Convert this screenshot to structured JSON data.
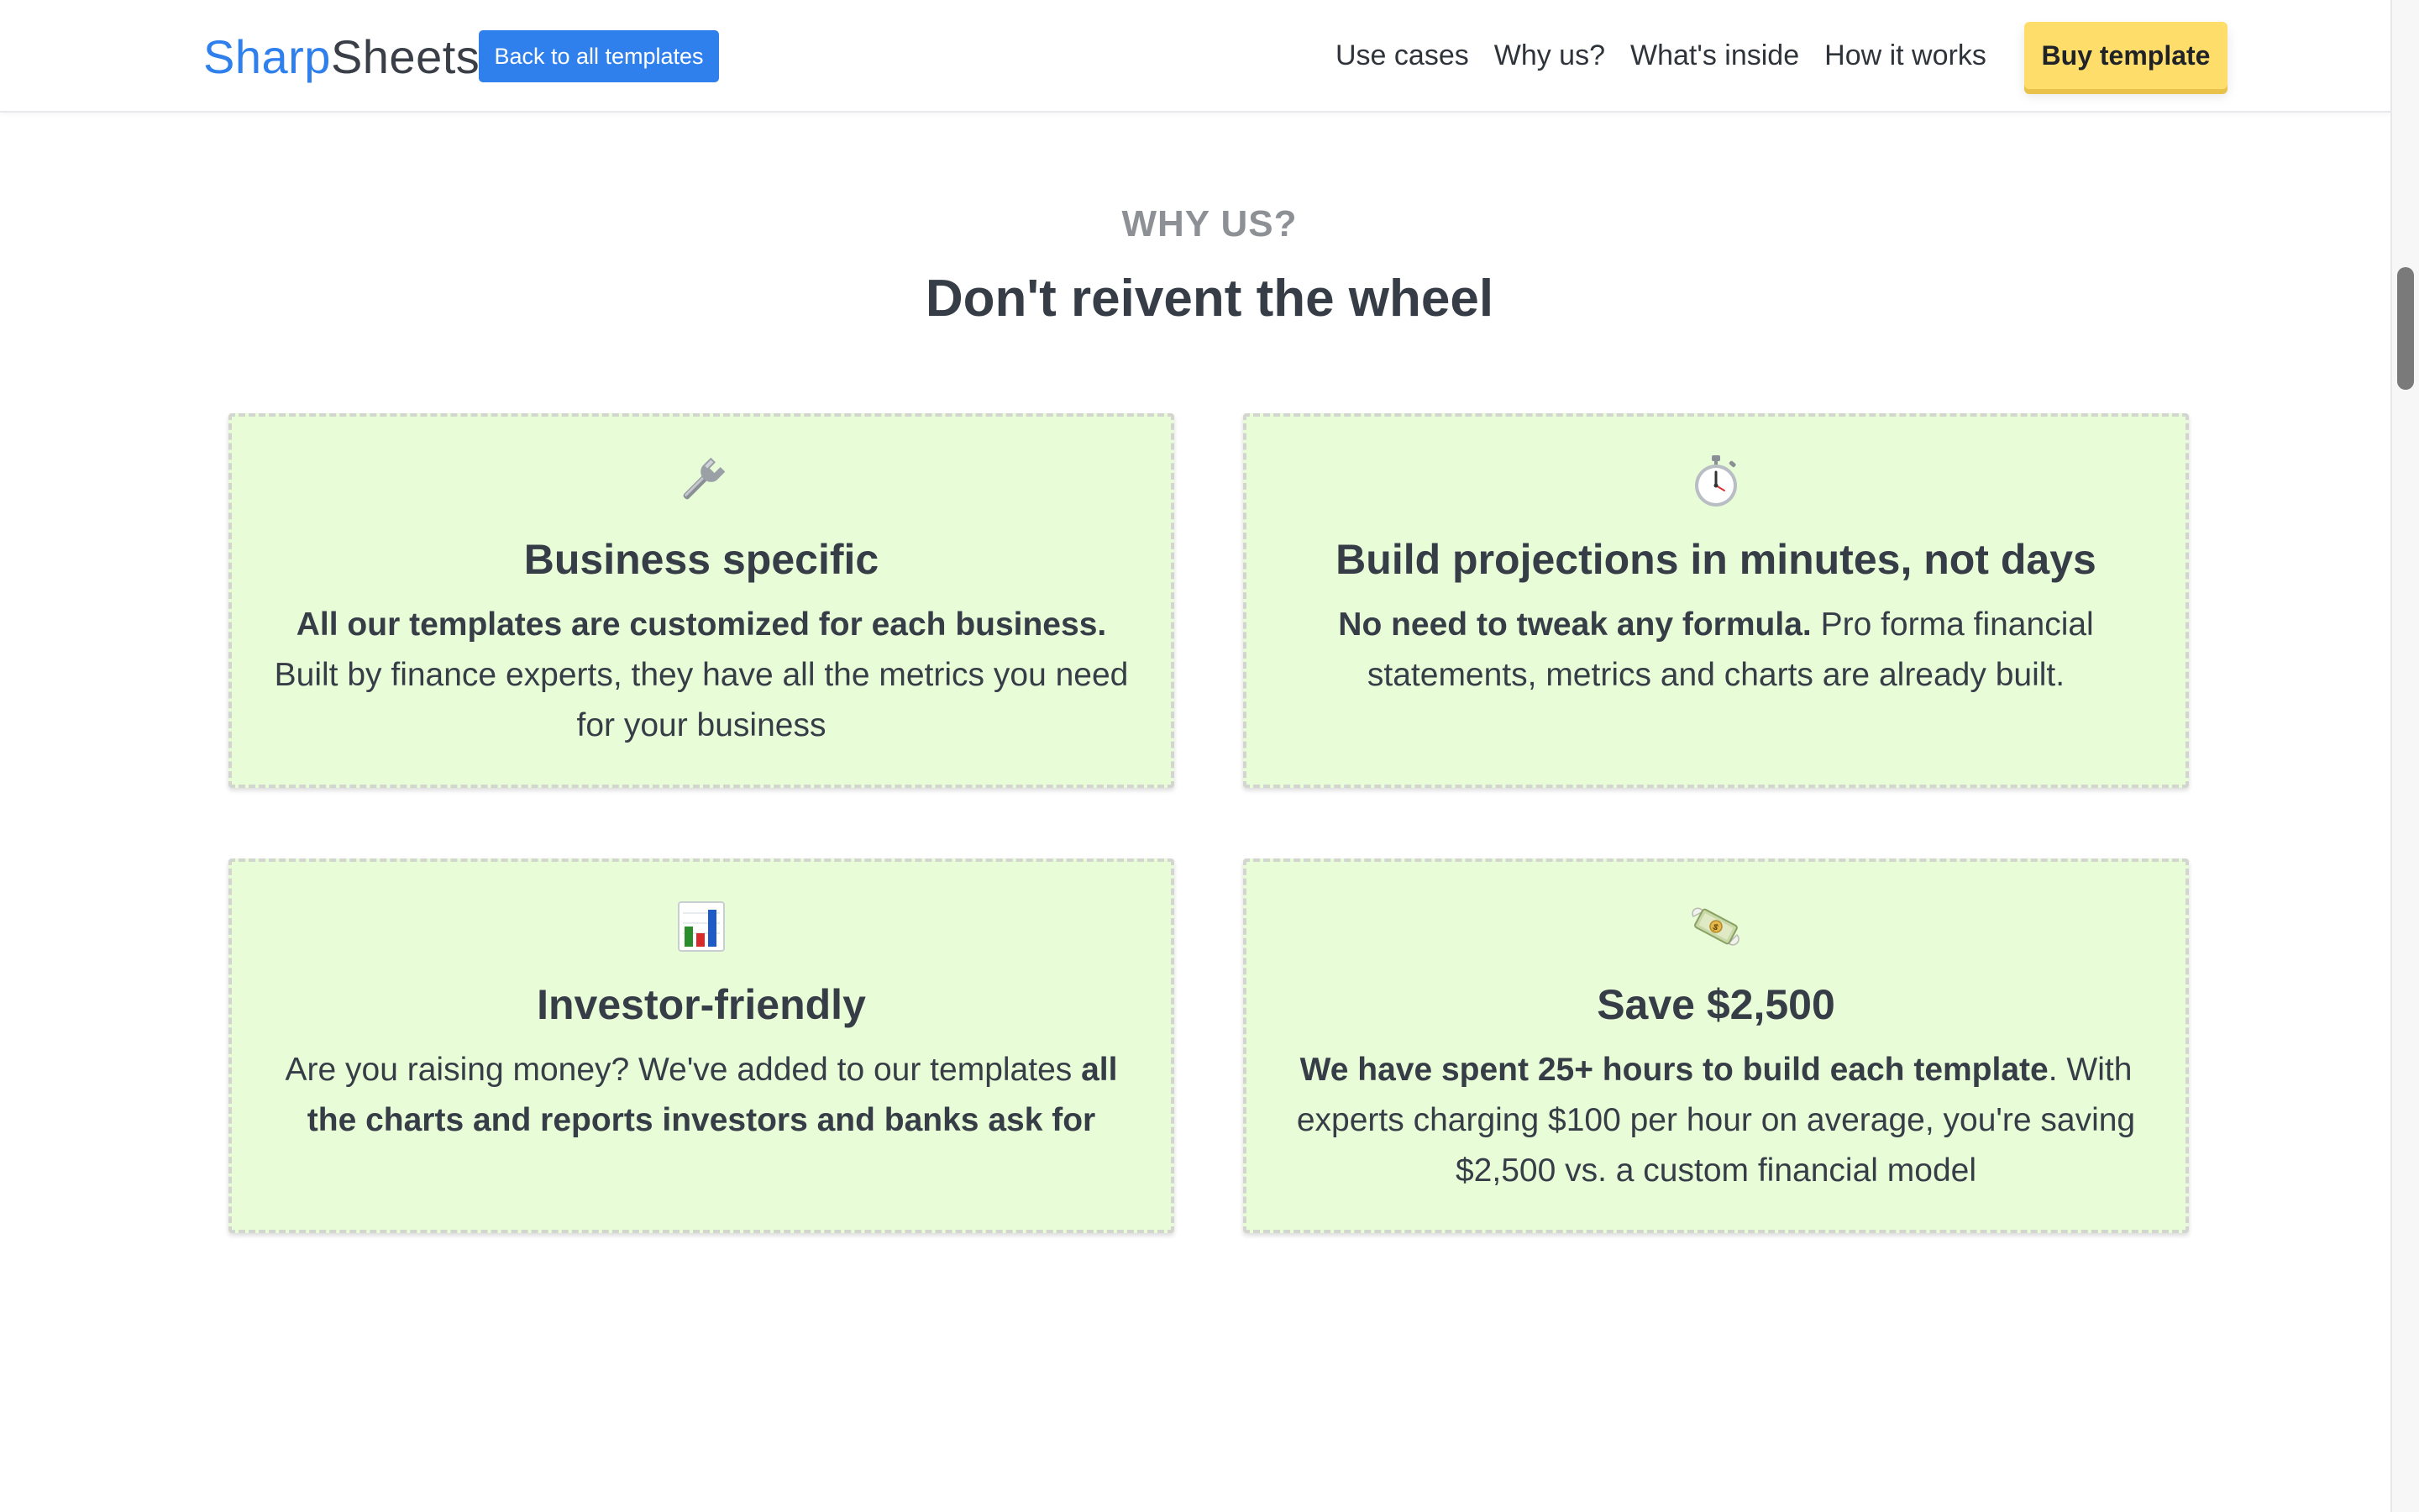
{
  "header": {
    "logo_part1": "Sharp",
    "logo_part2": "Sheets",
    "back_label": "Back to all templates",
    "nav": [
      "Use cases",
      "Why us?",
      "What's inside",
      "How it works"
    ],
    "buy_label": "Buy template"
  },
  "section": {
    "eyebrow": "WHY US?",
    "title": "Don't reivent the wheel"
  },
  "cards": [
    {
      "icon": "wrench-icon",
      "title": "Business specific",
      "bold": "All our templates are customized for each business.",
      "text": " Built by finance experts, they have all the metrics you need for your business",
      "bold_end": ""
    },
    {
      "icon": "stopwatch-icon",
      "title": "Build projections in minutes, not days",
      "bold": "No need to tweak any formula.",
      "text": " Pro forma financial statements, metrics and charts are already built.",
      "bold_end": ""
    },
    {
      "icon": "bar-chart-icon",
      "title": "Investor-friendly",
      "bold": "",
      "text": "Are you raising money? We've added to our templates ",
      "bold_end": "all the charts and reports investors and banks ask for"
    },
    {
      "icon": "money-with-wings-icon",
      "title": "Save $2,500",
      "bold": "We have spent 25+ hours to build each template",
      "text": ". With experts charging $100 per hour on average, you're saving $2,500 vs. a custom financial model",
      "bold_end": ""
    }
  ],
  "colors": {
    "brand_blue": "#2f80ed",
    "card_bg": "#e8fcd8",
    "buy_yellow": "#ffdd6b"
  }
}
